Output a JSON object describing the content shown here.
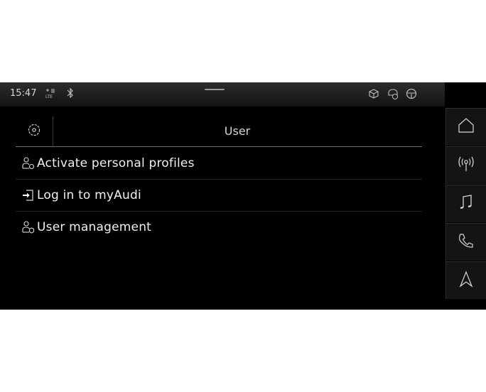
{
  "status_bar": {
    "time": "15:47",
    "network_icon": "lte-signal-icon",
    "bluetooth_icon": "bluetooth-icon",
    "right_icons": [
      "package-icon",
      "car-info-icon",
      "steering-wheel-icon"
    ]
  },
  "header": {
    "title": "User",
    "settings_icon": "settings-icon"
  },
  "menu": {
    "items": [
      {
        "label": "Activate personal profiles",
        "icon": "user-profile-icon"
      },
      {
        "label": "Log in to myAudi",
        "icon": "login-icon"
      },
      {
        "label": "User management",
        "icon": "user-profile-icon"
      }
    ]
  },
  "nav": {
    "items": [
      "home-icon",
      "radio-icon",
      "music-icon",
      "phone-icon",
      "navigation-icon"
    ]
  },
  "colors": {
    "background": "#000000",
    "text": "#f0f0f0",
    "divider": "#6d6d6d"
  }
}
